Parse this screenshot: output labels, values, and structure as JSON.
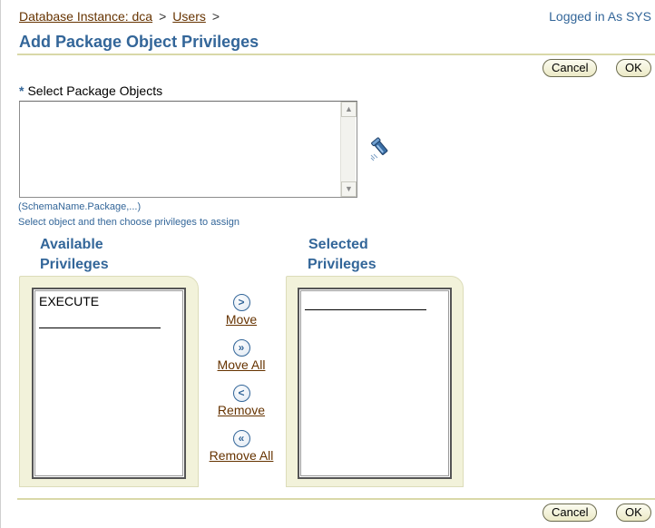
{
  "breadcrumb": {
    "items": [
      "Database Instance: dca",
      "Users"
    ],
    "separator": ">"
  },
  "header": {
    "login_text": "Logged in As SYS",
    "title": "Add Package Object Privileges"
  },
  "actions": {
    "cancel_label": "Cancel",
    "ok_label": "OK"
  },
  "select_objects": {
    "required_marker": "*",
    "label": "Select Package Objects",
    "value": "",
    "format_hint": "(SchemaName.Package,...)",
    "instruction": "Select object and then choose privileges to assign",
    "search_icon": "flashlight-icon"
  },
  "available": {
    "heading_line1": "Available",
    "heading_line2": "Privileges",
    "items": [
      "EXECUTE"
    ]
  },
  "selected": {
    "heading_line1": "Selected",
    "heading_line2": "Privileges",
    "items": []
  },
  "shuttle": {
    "move": {
      "symbol": ">",
      "label": "Move"
    },
    "move_all": {
      "symbol": "»",
      "label": "Move All"
    },
    "remove": {
      "symbol": "<",
      "label": "Remove"
    },
    "remove_all": {
      "symbol": "«",
      "label": "Remove All"
    }
  },
  "colors": {
    "title_blue": "#336699",
    "link_brown": "#663300",
    "panel_beige": "#f2f2da",
    "rule_tan": "#d9d8a8"
  }
}
